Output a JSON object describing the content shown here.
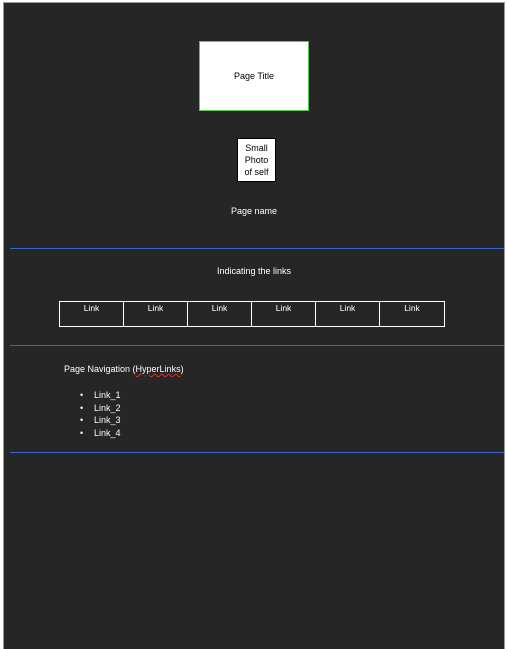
{
  "document": {
    "page_title_box": "Page Title",
    "photo_box": "Small\nPhoto\nof self",
    "page_name": "Page name",
    "links_heading": "Indicating the links",
    "link_cells": [
      "Link",
      "Link",
      "Link",
      "Link",
      "Link",
      "Link"
    ],
    "navigation": {
      "title_prefix": "Page Navigation (",
      "title_spell": "HyperLinks",
      "title_suffix": ")",
      "items": [
        "Link_1",
        "Link_2",
        "Link_3",
        "Link_4"
      ]
    }
  },
  "colors": {
    "page_background": "#262626",
    "divider": "#3d63c9",
    "title_box_border": "#55c94a"
  }
}
